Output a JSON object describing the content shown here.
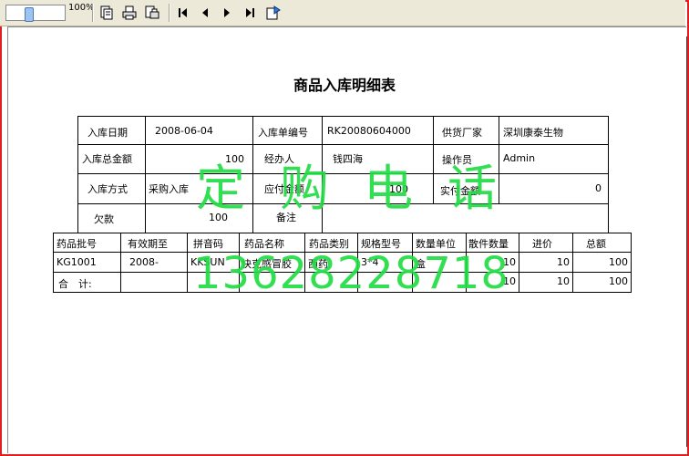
{
  "toolbar": {
    "zoom_label": "100%",
    "buttons": [
      "print-icon",
      "printer-icon",
      "print-setup-icon",
      "first-page-icon",
      "prev-page-icon",
      "next-page-icon",
      "last-page-icon",
      "export-icon"
    ]
  },
  "report": {
    "title": "商品入库明细表",
    "labels": {
      "in_date": "入库日期",
      "in_no": "入库单编号",
      "supplier": "供货厂家",
      "total": "入库总金额",
      "handler": "经办人",
      "operator": "操作员",
      "method": "入库方式",
      "payable": "应付金额",
      "paid": "实付金额",
      "owed": "欠款",
      "note": "备注"
    },
    "values": {
      "in_date": "2008-06-04",
      "in_no": "RK20080604000",
      "supplier": "深圳康泰生物",
      "total": "100",
      "handler": "钱四海",
      "operator": "Admin",
      "method": "采购入库",
      "payable": "100",
      "paid": "0",
      "owed": "100",
      "note": ""
    },
    "detail_headers": [
      "药品批号",
      "有效期至",
      "拼音码",
      "药品名称",
      "药品类别",
      "规格型号",
      "数量单位",
      "散件数量",
      "进价",
      "总额"
    ],
    "rows": [
      [
        "KG1001",
        "2008-",
        "KKSUN",
        "快克感冒胶",
        "西药",
        "3*4",
        "盒",
        "10",
        "10",
        "100"
      ]
    ],
    "totals": {
      "label": "合　计:",
      "qty": "10",
      "price": "10",
      "amount": "100"
    }
  },
  "watermark": {
    "line1": "定购电话",
    "line2": "13628228718",
    "color": "#22dd44"
  }
}
